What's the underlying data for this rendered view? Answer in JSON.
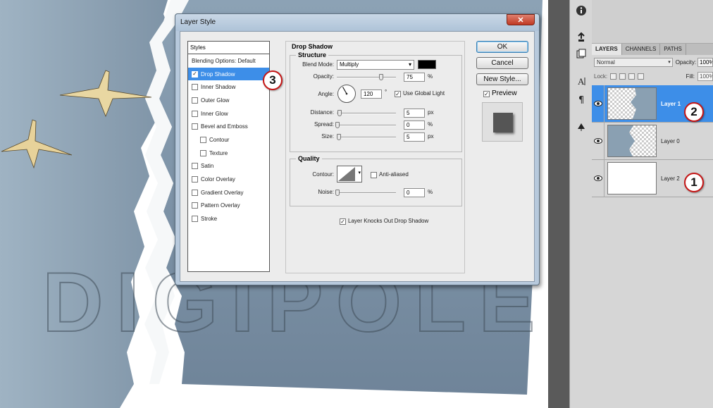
{
  "colors": {
    "sky": "#8aa0b2",
    "selection_blue": "#3d8ee8",
    "badge_border": "#c41515",
    "close_red": "#c03a24"
  },
  "canvas": {
    "watermark_text": "DIGIPOLE.EU",
    "icons": [
      "swan-icon",
      "swan-icon"
    ]
  },
  "dialog": {
    "title": "Layer Style",
    "close_icon": "close-icon",
    "styles": {
      "header": "Styles",
      "items": [
        {
          "label": "Blending Options: Default",
          "checkbox": false,
          "checked": false,
          "selected": false,
          "sub": false
        },
        {
          "label": "Drop Shadow",
          "checkbox": true,
          "checked": true,
          "selected": true,
          "sub": false
        },
        {
          "label": "Inner Shadow",
          "checkbox": true,
          "checked": false,
          "selected": false,
          "sub": false
        },
        {
          "label": "Outer Glow",
          "checkbox": true,
          "checked": false,
          "selected": false,
          "sub": false
        },
        {
          "label": "Inner Glow",
          "checkbox": true,
          "checked": false,
          "selected": false,
          "sub": false
        },
        {
          "label": "Bevel and Emboss",
          "checkbox": true,
          "checked": false,
          "selected": false,
          "sub": false
        },
        {
          "label": "Contour",
          "checkbox": true,
          "checked": false,
          "selected": false,
          "sub": true
        },
        {
          "label": "Texture",
          "checkbox": true,
          "checked": false,
          "selected": false,
          "sub": true
        },
        {
          "label": "Satin",
          "checkbox": true,
          "checked": false,
          "selected": false,
          "sub": false
        },
        {
          "label": "Color Overlay",
          "checkbox": true,
          "checked": false,
          "selected": false,
          "sub": false
        },
        {
          "label": "Gradient Overlay",
          "checkbox": true,
          "checked": false,
          "selected": false,
          "sub": false
        },
        {
          "label": "Pattern Overlay",
          "checkbox": true,
          "checked": false,
          "selected": false,
          "sub": false
        },
        {
          "label": "Stroke",
          "checkbox": true,
          "checked": false,
          "selected": false,
          "sub": false
        }
      ]
    },
    "drop_shadow": {
      "title": "Drop Shadow",
      "structure": {
        "title": "Structure",
        "blend_mode_label": "Blend Mode:",
        "blend_mode_value": "Multiply",
        "shadow_color": "#000000",
        "opacity_label": "Opacity:",
        "opacity_value": "75",
        "opacity_unit": "%",
        "opacity_fraction": 0.75,
        "angle_label": "Angle:",
        "angle_value": "120",
        "angle_unit": "°",
        "angle_degrees": 120,
        "use_global_light_label": "Use Global Light",
        "use_global_light_checked": true,
        "distance_label": "Distance:",
        "distance_value": "5",
        "distance_unit": "px",
        "spread_label": "Spread:",
        "spread_value": "0",
        "spread_unit": "%",
        "size_label": "Size:",
        "size_value": "5",
        "size_unit": "px"
      },
      "quality": {
        "title": "Quality",
        "contour_label": "Contour:",
        "anti_aliased_label": "Anti-aliased",
        "anti_aliased_checked": false,
        "noise_label": "Noise:",
        "noise_value": "0",
        "noise_unit": "%"
      },
      "knockout_label": "Layer Knocks Out Drop Shadow",
      "knockout_checked": true
    },
    "buttons": {
      "ok": "OK",
      "cancel": "Cancel",
      "new_style": "New Style...",
      "preview_label": "Preview",
      "preview_checked": true
    }
  },
  "tools": [
    "info-icon",
    "clone-source-icon",
    "history-brush-icon",
    "character-icon",
    "paragraph-icon",
    "tool-presets-icon"
  ],
  "layers_panel": {
    "tabs": [
      "LAYERS",
      "CHANNELS",
      "PATHS"
    ],
    "active_tab": "LAYERS",
    "blend_mode": "Normal",
    "opacity_label": "Opacity:",
    "opacity_value": "100%",
    "lock_label": "Lock:",
    "fill_label": "Fill:",
    "fill_value": "100%",
    "layers": [
      {
        "name": "Layer 1",
        "selected": true
      },
      {
        "name": "Layer 0",
        "selected": false
      },
      {
        "name": "Layer 2",
        "selected": false
      }
    ]
  },
  "badges": [
    "3",
    "2",
    "1"
  ]
}
